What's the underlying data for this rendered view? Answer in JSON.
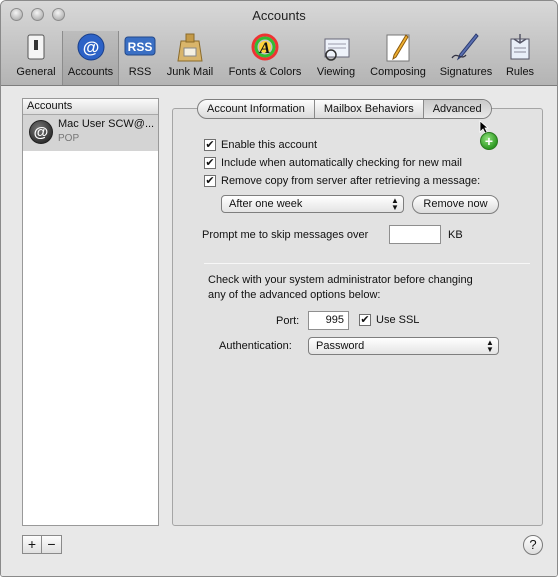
{
  "window": {
    "title": "Accounts"
  },
  "toolbar": {
    "items": [
      {
        "label": "General",
        "icon": "switch-icon"
      },
      {
        "label": "Accounts",
        "icon": "at-sign-icon"
      },
      {
        "label": "RSS",
        "icon": "rss-icon"
      },
      {
        "label": "Junk Mail",
        "icon": "junk-mail-bag-icon"
      },
      {
        "label": "Fonts & Colors",
        "icon": "font-colors-icon"
      },
      {
        "label": "Viewing",
        "icon": "viewing-icon"
      },
      {
        "label": "Composing",
        "icon": "composing-pencil-icon"
      },
      {
        "label": "Signatures",
        "icon": "signature-pen-icon"
      },
      {
        "label": "Rules",
        "icon": "rules-icon"
      }
    ],
    "selected": "Accounts"
  },
  "accounts_list": {
    "header": "Accounts",
    "items": [
      {
        "name": "Mac User SCW@...",
        "type": "POP"
      }
    ],
    "add_label": "+",
    "remove_label": "−"
  },
  "tabs": [
    {
      "label": "Account Information"
    },
    {
      "label": "Mailbox Behaviors"
    },
    {
      "label": "Advanced"
    }
  ],
  "active_tab": "Advanced",
  "advanced": {
    "enable_account": {
      "label": "Enable this account",
      "checked": true
    },
    "include_check": {
      "label": "Include when automatically checking for new mail",
      "checked": true
    },
    "remove_copy": {
      "label": "Remove copy from server after retrieving a message:",
      "checked": true
    },
    "remove_after": {
      "selected": "After one week"
    },
    "remove_now_label": "Remove now",
    "skip_prompt": {
      "label": "Prompt me to skip messages over",
      "value": "",
      "unit": "KB"
    },
    "admin_note_line1": "Check with your system administrator before changing",
    "admin_note_line2": "any of the advanced options below:",
    "port": {
      "label": "Port:",
      "value": "995"
    },
    "use_ssl": {
      "label": "Use SSL",
      "checked": true
    },
    "authentication": {
      "label": "Authentication:",
      "selected": "Password"
    }
  },
  "help_label": "?",
  "checkmark": "✔",
  "colors": {
    "rss_blue": "#3a6fc4",
    "add_green": "#2f9a24"
  }
}
